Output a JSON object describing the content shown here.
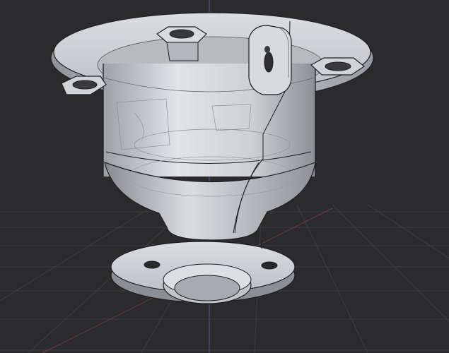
{
  "viewport": {
    "background_color": "#2b2b2d",
    "grid_color": "#3d3e43",
    "axis_blue_color": "#4a5a86",
    "axis_red_color": "#7a3b45",
    "model_body_color": "#c7c8cc",
    "model_edge_color": "#1e1e22"
  },
  "model": {
    "features": [
      "top-mounting-flange",
      "hexagonal-nut-pocket",
      "mounting-hole",
      "cable-clip-tab",
      "upper-cylinder-body",
      "conical-transition",
      "neck",
      "bottom-mounting-flange",
      "center-bore"
    ]
  }
}
